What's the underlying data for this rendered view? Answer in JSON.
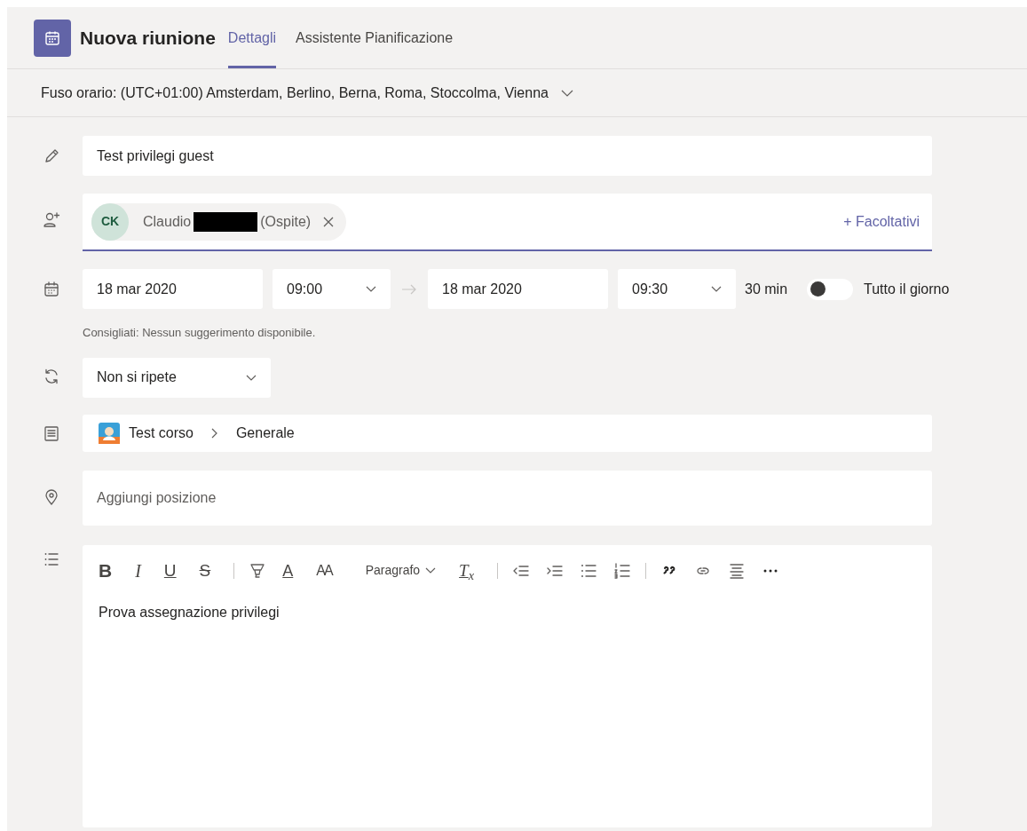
{
  "header": {
    "title": "Nuova riunione",
    "tabs": [
      {
        "label": "Dettagli",
        "selected": true
      },
      {
        "label": "Assistente Pianificazione",
        "selected": false
      }
    ]
  },
  "timezone": {
    "label": "Fuso orario: (UTC+01:00) Amsterdam, Berlino, Berna, Roma, Stoccolma, Vienna"
  },
  "title_field": {
    "value": "Test privilegi guest"
  },
  "attendees": {
    "people": [
      {
        "initials": "CK",
        "name": "Claudio",
        "redacted": true,
        "tag": "(Ospite)"
      }
    ],
    "optional_link": "+ Facoltativi"
  },
  "schedule": {
    "start_date": "18 mar 2020",
    "start_time": "09:00",
    "end_date": "18 mar 2020",
    "end_time": "09:30",
    "duration": "30 min",
    "all_day": {
      "label": "Tutto il giorno",
      "on": false
    },
    "suggestion": "Consigliati: Nessun suggerimento disponibile."
  },
  "repeat": {
    "value": "Non si ripete"
  },
  "channel": {
    "team": "Test corso",
    "channel": "Generale"
  },
  "location": {
    "placeholder": "Aggiungi posizione"
  },
  "editor": {
    "toolbar": [
      {
        "kind": "bold",
        "label": "B"
      },
      {
        "kind": "italic",
        "label": "I"
      },
      {
        "kind": "underline",
        "label": "U"
      },
      {
        "kind": "strike",
        "label": "S"
      },
      {
        "kind": "divider"
      },
      {
        "kind": "highlight"
      },
      {
        "kind": "font-color",
        "label": "A"
      },
      {
        "kind": "font-size",
        "label": "AA"
      },
      {
        "kind": "dropdown",
        "label": "Paragrafo"
      },
      {
        "kind": "clear-format",
        "label": "T$_{x}$"
      },
      {
        "kind": "divider"
      },
      {
        "kind": "outdent"
      },
      {
        "kind": "indent"
      },
      {
        "kind": "bullets"
      },
      {
        "kind": "numbers"
      },
      {
        "kind": "divider"
      },
      {
        "kind": "quote"
      },
      {
        "kind": "link"
      },
      {
        "kind": "align"
      },
      {
        "kind": "more"
      }
    ],
    "body": "Prova assegnazione privilegi"
  }
}
